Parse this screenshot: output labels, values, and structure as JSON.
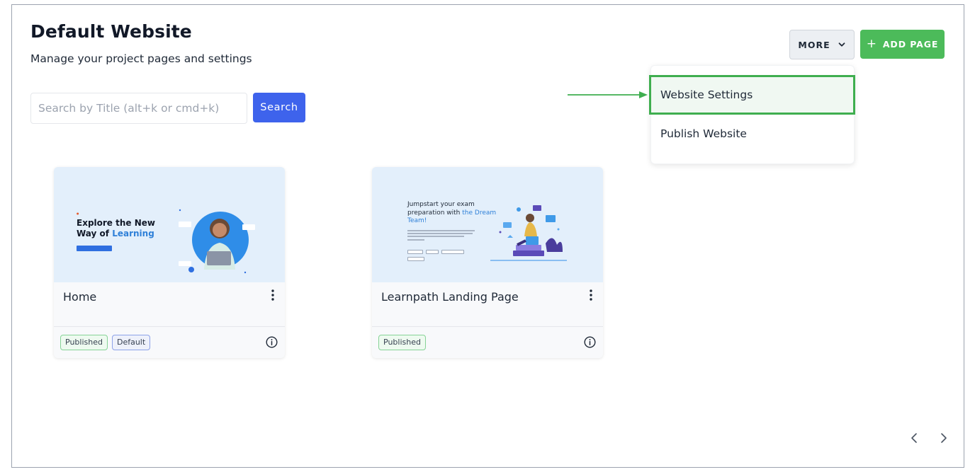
{
  "header": {
    "title": "Default Website",
    "subtitle": "Manage your project pages and settings"
  },
  "search": {
    "placeholder": "Search by Title (alt+k or cmd+k)",
    "value": "",
    "button_label": "Search"
  },
  "toolbar": {
    "more_label": "MORE",
    "add_page_label": "ADD PAGE"
  },
  "more_menu": {
    "items": [
      {
        "label": "Website Settings",
        "highlighted": true
      },
      {
        "label": "Publish Website",
        "highlighted": false
      }
    ]
  },
  "pages": [
    {
      "title": "Home",
      "badges": [
        "Published",
        "Default"
      ],
      "thumbnail": {
        "heading_prefix": "Explore the New Way of ",
        "heading_highlight": "Learning"
      }
    },
    {
      "title": "Learnpath Landing Page",
      "badges": [
        "Published"
      ],
      "thumbnail": {
        "heading_prefix": "Jumpstart your exam preparation with ",
        "heading_highlight": "the Dream Team!"
      }
    }
  ],
  "colors": {
    "search_button": "#3e63ec",
    "add_page_button": "#4cbb5a",
    "highlight_border": "#3fae4f",
    "annotation_arrow": "#3fae4f"
  },
  "icons": {
    "more_chevron": "chevron-down-icon",
    "add": "plus-icon",
    "card_menu": "kebab-menu-icon",
    "card_info": "info-icon",
    "prev": "chevron-left-icon",
    "next": "chevron-right-icon"
  }
}
